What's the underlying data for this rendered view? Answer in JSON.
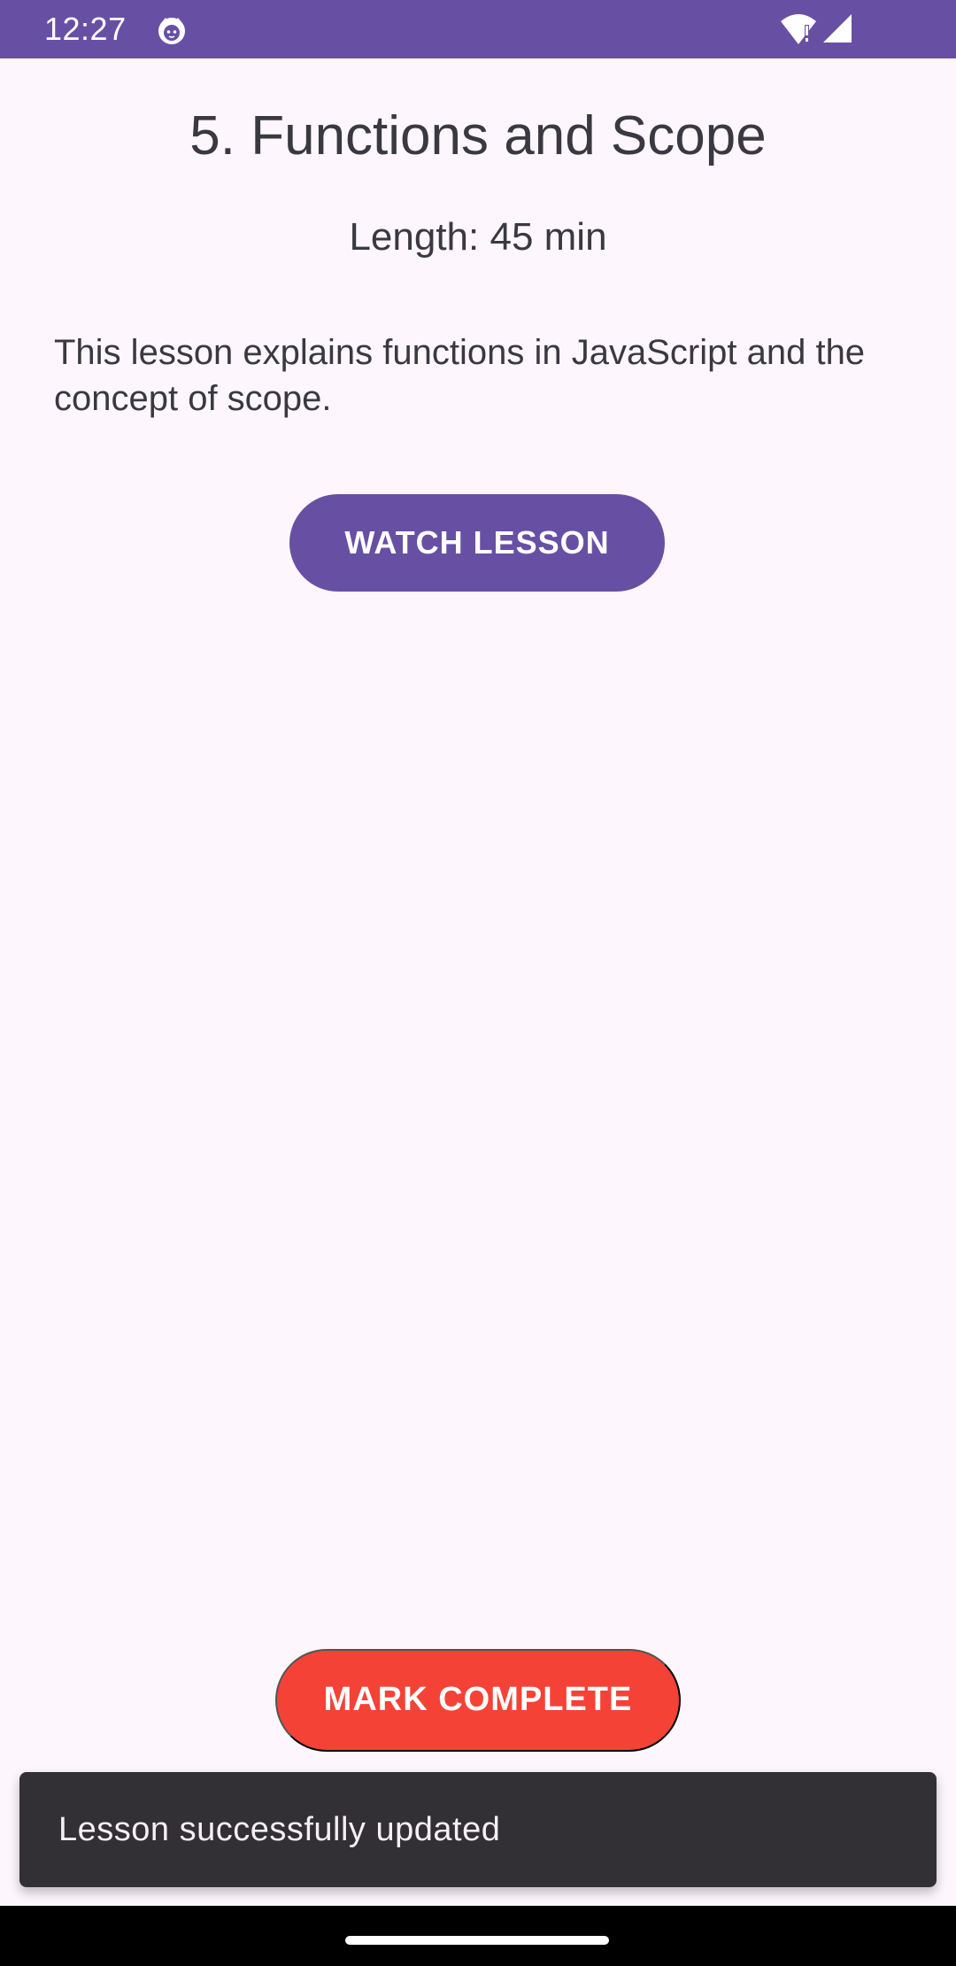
{
  "status_bar": {
    "time": "12:27",
    "app_icon": "cat-face-icon",
    "wifi_icon": "wifi-alert-icon",
    "signal_icon": "cell-signal-icon",
    "color": "#6750A4"
  },
  "lesson": {
    "title": "5. Functions and Scope",
    "length": "Length: 45 min",
    "description": "This lesson explains functions in JavaScript and the concept of scope."
  },
  "actions": {
    "watch_label": "WATCH LESSON",
    "mark_complete_label": "MARK COMPLETE",
    "primary_color": "#6750A4",
    "complete_color": "#F44336"
  },
  "snackbar": {
    "message": "Lesson successfully updated"
  },
  "navigation_bar": {
    "handle_icon": "gesture-handle"
  }
}
